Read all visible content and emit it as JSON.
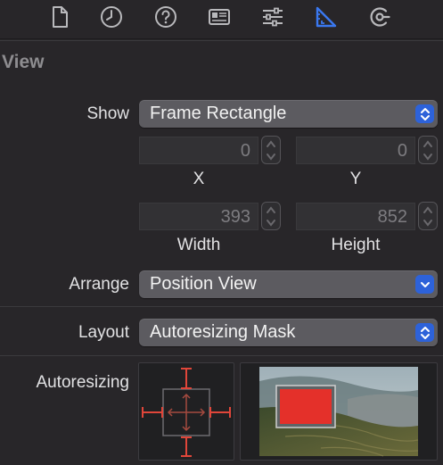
{
  "toolbar": {
    "icons": [
      "file-icon",
      "history-icon",
      "help-icon",
      "identity-inspector-icon",
      "attributes-icon",
      "size-inspector-icon",
      "connections-icon"
    ],
    "active": "size-inspector-icon",
    "accent": "#3a78f0"
  },
  "section": {
    "title": "View"
  },
  "show": {
    "label": "Show",
    "value": "Frame Rectangle"
  },
  "frame": {
    "x": {
      "value": "0",
      "label": "X"
    },
    "y": {
      "value": "0",
      "label": "Y"
    },
    "width": {
      "value": "393",
      "label": "Width"
    },
    "height": {
      "value": "852",
      "label": "Height"
    }
  },
  "arrange": {
    "label": "Arrange",
    "value": "Position View"
  },
  "layout": {
    "label": "Layout",
    "value": "Autoresizing Mask"
  },
  "autoresizing": {
    "label": "Autoresizing",
    "strut_color": "#e0463a"
  },
  "colors": {
    "background": "#282629",
    "popup": "#5c5b60",
    "popup_button": "#2d62d9",
    "preview_rect": "#e4302a"
  }
}
